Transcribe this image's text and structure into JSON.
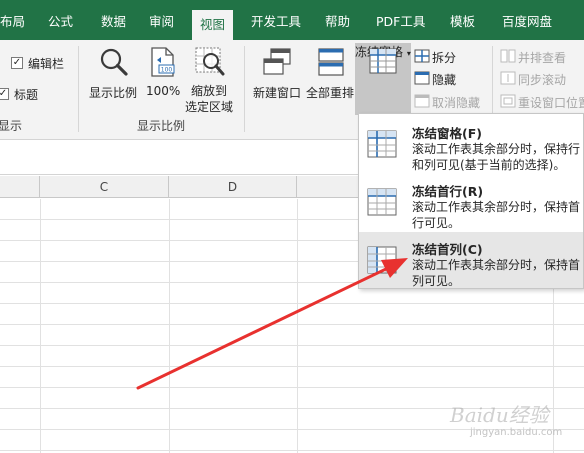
{
  "tabs": [
    {
      "label": "布局",
      "active": false
    },
    {
      "label": "公式",
      "active": false
    },
    {
      "label": "数据",
      "active": false
    },
    {
      "label": "审阅",
      "active": false
    },
    {
      "label": "视图",
      "active": true
    },
    {
      "label": "开发工具",
      "active": false
    },
    {
      "label": "帮助",
      "active": false
    },
    {
      "label": "PDF工具",
      "active": false
    },
    {
      "label": "模板",
      "active": false
    },
    {
      "label": "百度网盘",
      "active": false
    }
  ],
  "ribbon": {
    "show_group": {
      "formula_bar": {
        "label": "编辑栏",
        "checked": true
      },
      "headings": {
        "label": "标题",
        "checked": true
      },
      "group_label": "显示"
    },
    "zoom_group": {
      "zoom_label": "显示比例",
      "zoom100_label": "100%",
      "zoom_selection_label_1": "缩放到",
      "zoom_selection_label_2": "选定区域",
      "group_label": "显示比例"
    },
    "window_group": {
      "new_window_label": "新建窗口",
      "arrange_all_label": "全部重排",
      "freeze_panes_label": "冻结窗格",
      "split_label": "拆分",
      "hide_label": "隐藏",
      "unhide_label": "取消隐藏",
      "side_by_side_label": "并排查看",
      "sync_scroll_label": "同步滚动",
      "reset_position_label": "重设窗口位置"
    }
  },
  "columns": [
    "C",
    "D"
  ],
  "dropdown": {
    "items": [
      {
        "title": "冻结窗格(F)",
        "desc": "滚动工作表其余部分时，保持行和列可见(基于当前的选择)。"
      },
      {
        "title": "冻结首行(R)",
        "desc": "滚动工作表其余部分时，保持首行可见。"
      },
      {
        "title": "冻结首列(C)",
        "desc": "滚动工作表其余部分时，保持首列可见。"
      }
    ]
  },
  "watermark": {
    "text": "Baidu经验",
    "url": "jingyan.baidu.com"
  },
  "colors": {
    "tabbar": "#217346",
    "ribbon": "#f3f3f3",
    "arrow": "#e8312f",
    "accent": "#217346"
  }
}
